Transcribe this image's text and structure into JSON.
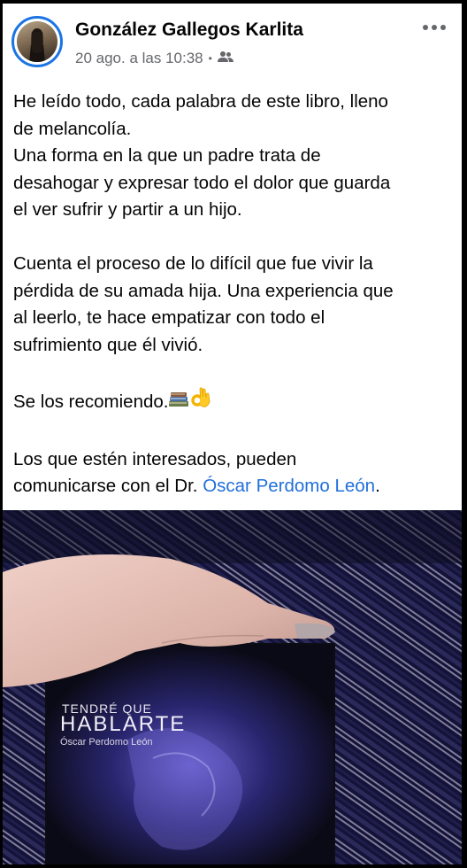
{
  "post": {
    "author": "González Gallegos Karlita",
    "timestamp": "20 ago. a las 10:38",
    "separator": "•",
    "audience_icon": "friends-icon",
    "paragraph1_lines": [
      "He leído todo, cada palabra de este libro, lleno",
      "de melancolía.",
      "Una forma en la que un padre trata de",
      "desahogar y expresar todo el dolor que guarda",
      "el ver sufrir y partir a un hijo."
    ],
    "paragraph2_lines": [
      "Cuenta el proceso de lo difícil que fue vivir la",
      "pérdida de su amada hija. Una experiencia que",
      "al leerlo, te hace empatizar con todo el",
      "sufrimiento que él vivió."
    ],
    "recommend_text": "Se los recomiendo.",
    "recommend_emojis": [
      "books-icon",
      "ok-hand-icon"
    ],
    "contact_line1": "Los que estén interesados, pueden",
    "contact_line2_prefix": "comunicarse con el Dr. ",
    "contact_link": "Óscar Perdomo León",
    "contact_line2_suffix": "."
  },
  "book": {
    "title_line1": "TENDRÉ QUE",
    "title_line2": "HABLARTE",
    "author": "Óscar Perdomo León"
  },
  "colors": {
    "link": "#216fdb",
    "avatar_ring": "#1b74e4",
    "meta_text": "#65676b"
  }
}
